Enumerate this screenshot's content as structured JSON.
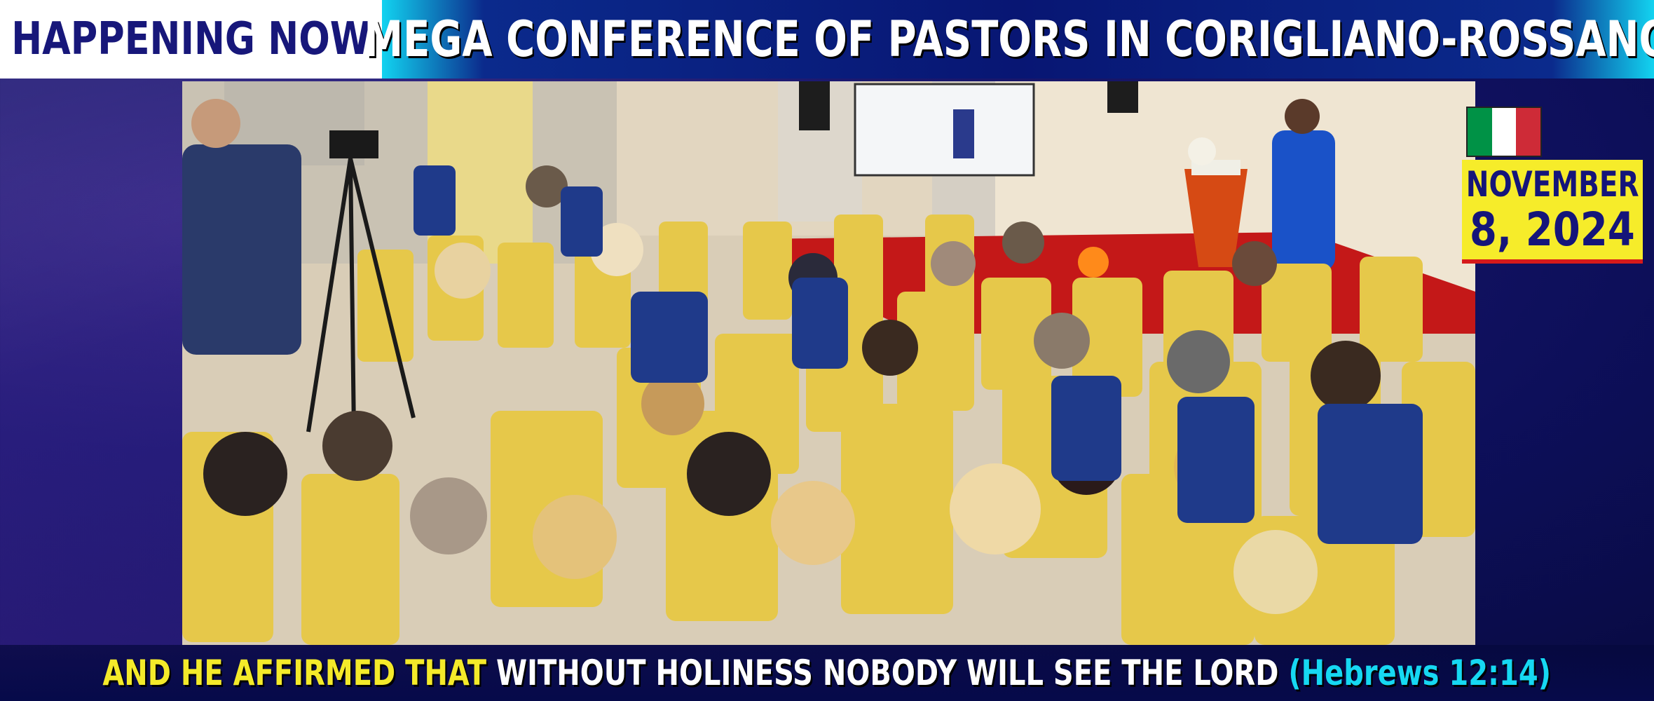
{
  "header": {
    "badge": "HAPPENING NOW",
    "title": "MEGA CONFERENCE OF PASTORS IN CORIGLIANO-ROSSANO"
  },
  "date": {
    "month": "NOVEMBER",
    "day_year": "8, 2024"
  },
  "flag": {
    "colors": [
      "#009246",
      "#ffffff",
      "#ce2b37"
    ]
  },
  "caption": {
    "part1": "AND HE AFFIRMED THAT",
    "part2": "WITHOUT HOLINESS NOBODY WILL SEE THE LORD",
    "part3": "(Hebrews 12:14)"
  },
  "colors": {
    "accent_yellow": "#f4ea2a",
    "accent_cyan": "#16d8f2",
    "navy": "#15157a"
  }
}
